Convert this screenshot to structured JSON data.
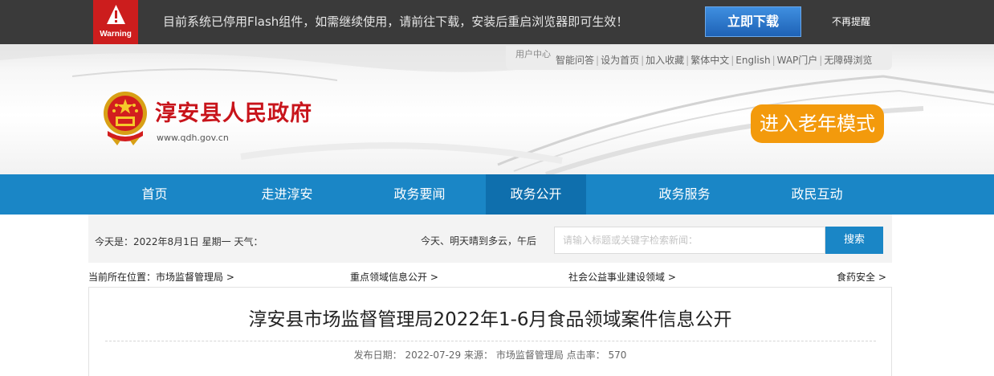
{
  "flash_banner": {
    "warning_label": "Warning",
    "message": "目前系统已停用Flash组件，如需继续使用，请前往下载，安装后重启浏览器即可生效！",
    "download_label": "立即下载",
    "dismiss_label": "不再提醒"
  },
  "top_links": {
    "user_center": "用户中心",
    "items": [
      "智能问答",
      "设为首页",
      "加入收藏",
      "繁体中文",
      "English",
      "WAP门户",
      "无障碍浏览"
    ]
  },
  "site": {
    "name": "淳安县人民政府",
    "url": "www.qdh.gov.cn",
    "elder_mode_label": "进入老年模式"
  },
  "nav": {
    "items": [
      "首页",
      "走进淳安",
      "政务要闻",
      "政务公开",
      "政务服务",
      "政民互动"
    ],
    "active_index": 3
  },
  "info_bar": {
    "date_text": "今天是：2022年8月1日 星期一    天气：",
    "weather": "今天、明天晴到多云，午后",
    "search_placeholder": "请输入标题或关键字检索新闻：",
    "search_label": "搜索"
  },
  "breadcrumb": {
    "label": "当前所在位置：",
    "items": [
      "市场监督管理局 >",
      "重点领域信息公开 >",
      "社会公益事业建设领域 >",
      "食药安全 >"
    ]
  },
  "article": {
    "title": "淳安县市场监督管理局2022年1-6月食品领域案件信息公开",
    "meta": "发布日期： 2022-07-29 来源： 市场监督管理局 点击率： 570"
  },
  "colors": {
    "nav_bg": "#1a86c6",
    "nav_active": "#0f6fad",
    "brand_red": "#c8141b",
    "elder_orange": "#f39a0c",
    "warning_red": "#cc1d1d"
  }
}
